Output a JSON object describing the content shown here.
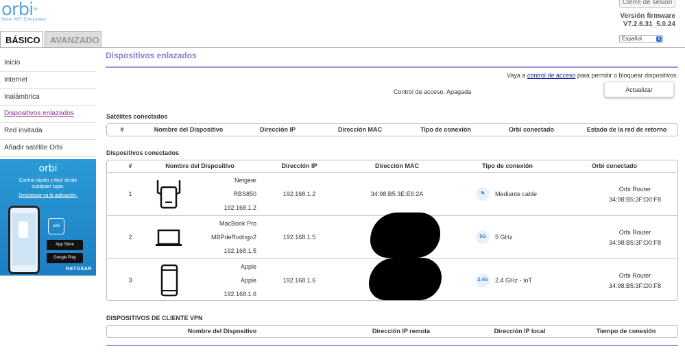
{
  "brand": {
    "logo_text": "orbi",
    "tm": "TM",
    "tagline": "Better WiFi. Everywhere."
  },
  "header": {
    "logout_label": "Cierre de sesión",
    "firmware_label": "Versión firmware",
    "firmware_version": "V7.2.6.31_5.0.24",
    "language": "Español",
    "tabs": [
      {
        "label": "BÁSICO"
      },
      {
        "label": "AVANZADO"
      }
    ]
  },
  "sidebar": {
    "items": [
      {
        "label": "Inicio"
      },
      {
        "label": "Internet"
      },
      {
        "label": "Inalámbrica"
      },
      {
        "label": "Dispositivos enlazados"
      },
      {
        "label": "Red invitada"
      },
      {
        "label": "Añadir satélite Orbi"
      }
    ],
    "promo": {
      "logo": "orbi",
      "text": "Control rápido y fácil desde cualquier lugar.",
      "link": "Descargue ya la aplicación.",
      "app_store": "App Store",
      "google_play": "Google Play",
      "netgear": "NETGEAR"
    }
  },
  "main": {
    "title": "Dispositivos enlazados",
    "access_prefix": "Vaya a",
    "access_link": "control de acceso",
    "access_suffix": "para permitir o bloquear dispositivos.",
    "access_state": "Control de acceso: Apagada",
    "refresh_label": "Actualizar",
    "satellites": {
      "title": "Satélites conectados",
      "headers": [
        "#",
        "Nombre del Dispositivo",
        "Dirección IP",
        "Dirección MAC",
        "Tipo de conexión",
        "Orbi conectado",
        "Estado de la red de retorno"
      ]
    },
    "devices": {
      "title": "Dispositivos conectados",
      "headers": [
        "#",
        "Nombre del Dispositivo",
        "Dirección IP",
        "Dirección MAC",
        "Tipo de conexión",
        "Orbi conectado"
      ],
      "rows": [
        {
          "num": "1",
          "icon": "extender-icon",
          "name1": "Netgear",
          "name2": "RBS850",
          "name3": "192.168.1.2",
          "ip": "192.168.1.2",
          "mac": "34:98:B5:3E:E6:2A",
          "conn_icon": "wired-icon",
          "conn_badge": "",
          "conn": "Mediante cable",
          "orbi": "Orbi Router",
          "orbi_mac": "34:98:B5:3F:D0:F8"
        },
        {
          "num": "2",
          "icon": "laptop-icon",
          "name1": "MacBook Pro",
          "name2": "MBPdeRodrigo2",
          "name3": "192.168.1.5",
          "ip": "192.168.1.5",
          "mac": "",
          "conn_icon": "wifi-5g-icon",
          "conn_badge": "5G",
          "conn": "5 GHz",
          "orbi": "Orbi Router",
          "orbi_mac": "34:98:B5:3F:D0:F8"
        },
        {
          "num": "3",
          "icon": "phone-icon",
          "name1": "Apple",
          "name2": "Apple",
          "name3": "192.168.1.6",
          "ip": "192.168.1.6",
          "mac": "",
          "conn_icon": "wifi-2g-icon",
          "conn_badge": "2.4G",
          "conn": "2.4 GHz - IoT",
          "orbi": "Orbi Router",
          "orbi_mac": "34:98:B5:3F:D0:F8"
        }
      ]
    },
    "vpn": {
      "title": "DISPOSITIVOS DE CLIENTE VPN",
      "headers": [
        "Nombre del Dispositivo",
        "Dirección IP remota",
        "Dirección IP local",
        "Tiempo de conexión"
      ]
    }
  }
}
